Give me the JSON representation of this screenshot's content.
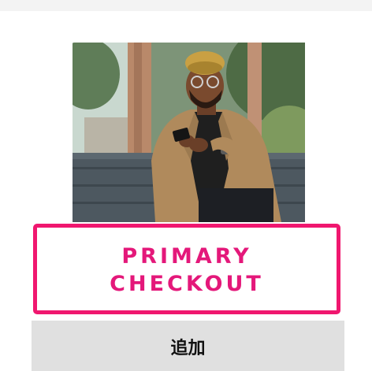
{
  "product": {
    "image_description": "man-in-tan-blazer-using-phone"
  },
  "checkout": {
    "label": "PRIMARY\nCHECKOUT",
    "accent_color": "#f0176f"
  },
  "cart": {
    "add_label": "追加"
  }
}
